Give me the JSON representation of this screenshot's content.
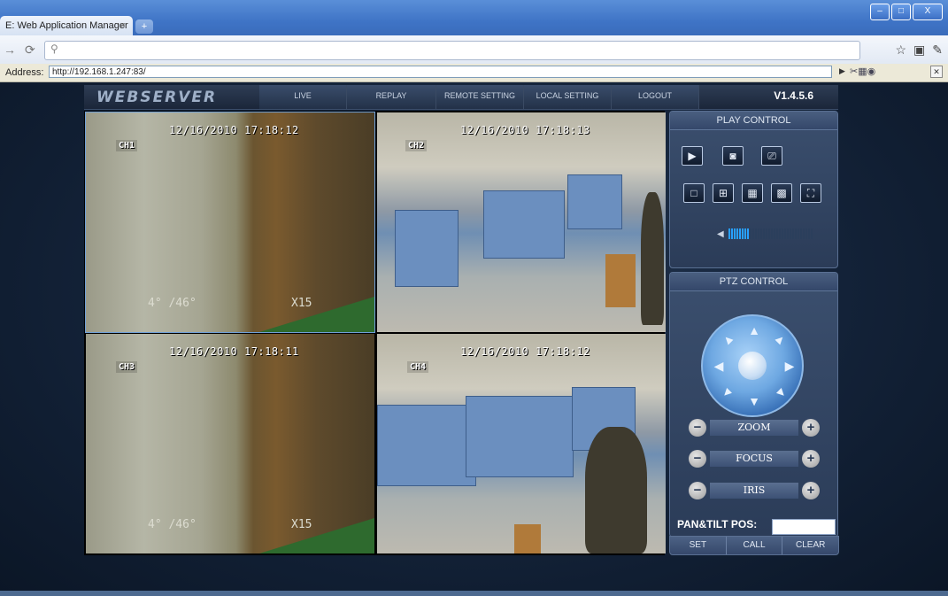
{
  "browser": {
    "tab_title": "E: Web Application Manager",
    "tab_close": "×",
    "new_tab": "+",
    "window_buttons": [
      "–",
      "□",
      "X"
    ],
    "address_label": "Address:",
    "address_url": "http://192.168.1.247:83/"
  },
  "app": {
    "logo": "WEBSERVER",
    "menu": [
      "LIVE",
      "REPLAY",
      "REMOTE SETTING",
      "LOCAL SETTING",
      "LOGOUT"
    ],
    "version": "V1.4.5.6"
  },
  "cameras": [
    {
      "channel": "CH1",
      "timestamp": "12/16/2010 17:18:12",
      "position": "4° /46°",
      "zoom": "X15"
    },
    {
      "channel": "CH2",
      "timestamp": "12/16/2010 17:18:13"
    },
    {
      "channel": "CH3",
      "timestamp": "12/16/2010 17:18:11",
      "position": "4° /46°",
      "zoom": "X15"
    },
    {
      "channel": "CH4",
      "timestamp": "12/16/2010 17:18:12"
    }
  ],
  "play_control": {
    "title": "PLAY CONTROL",
    "volume_level": 0.25
  },
  "ptz_control": {
    "title": "PTZ CONTROL",
    "zoom_label": "ZOOM",
    "focus_label": "FOCUS",
    "iris_label": "IRIS",
    "pan_tilt_label": "PAN&TILT POS:",
    "pan_tilt_value": "",
    "set_label": "SET",
    "call_label": "CALL",
    "clear_label": "CLEAR"
  }
}
